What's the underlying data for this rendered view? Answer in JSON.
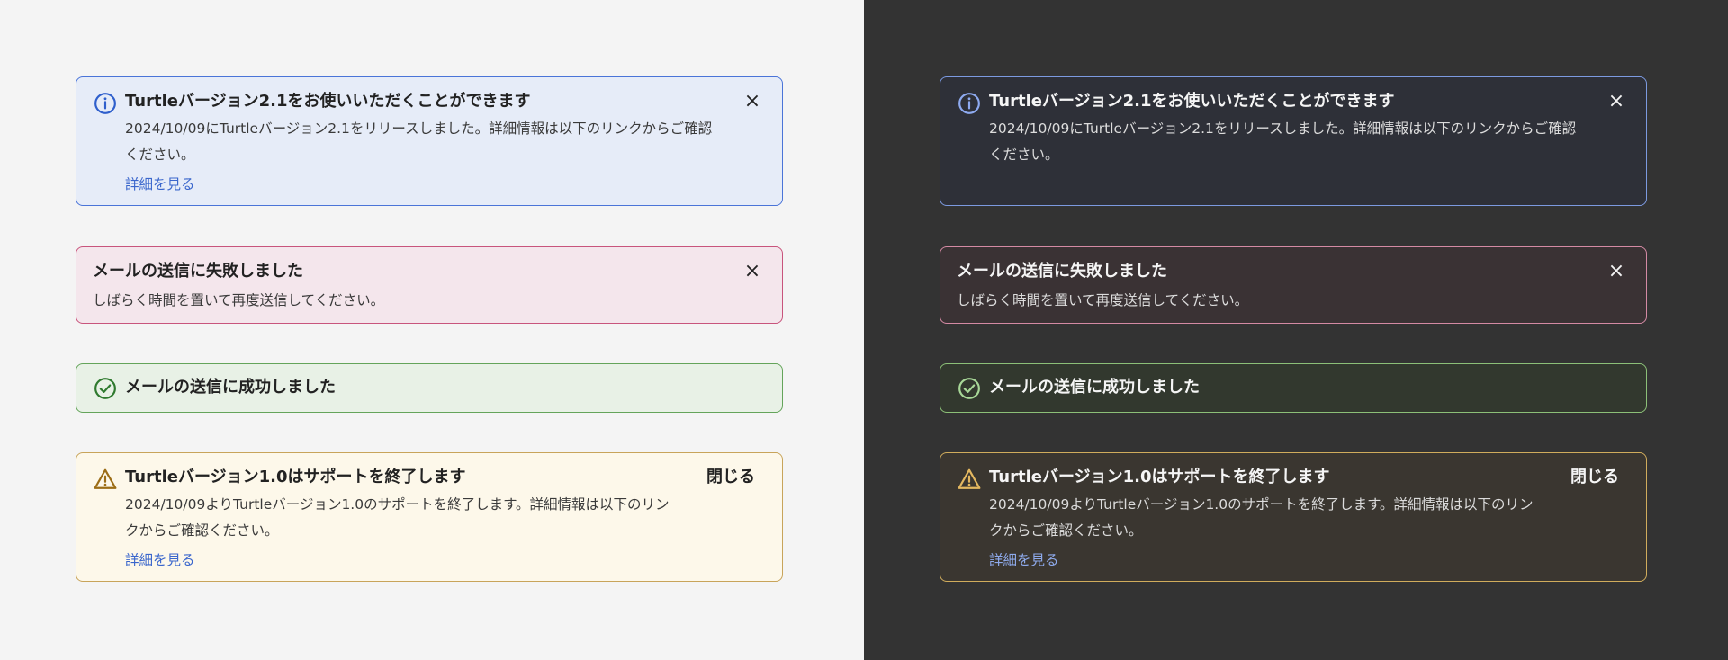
{
  "light": {
    "info": {
      "icon": "info-circle-icon",
      "title": "Turtleバージョン2.1をお使いいただくことができます",
      "body": "2024/10/09にTurtleバージョン2.1をリリースしました。詳細情報は以下のリンクからご確認ください。",
      "link": "詳細を見る",
      "close": "×"
    },
    "error": {
      "title": "メールの送信に失敗しました",
      "body": "しばらく時間を置いて再度送信してください。",
      "close": "×"
    },
    "success": {
      "icon": "check-circle-icon",
      "title": "メールの送信に成功しました"
    },
    "warning": {
      "icon": "warning-triangle-icon",
      "title": "Turtleバージョン1.0はサポートを終了します",
      "body": "2024/10/09よりTurtleバージョン1.0のサポートを終了します。詳細情報は以下のリンクからご確認ください。",
      "link": "詳細を見る",
      "close": "閉じる"
    }
  },
  "dark": {
    "info": {
      "icon": "info-circle-icon",
      "title": "Turtleバージョン2.1をお使いいただくことができます",
      "body": "2024/10/09にTurtleバージョン2.1をリリースしました。詳細情報は以下のリンクからご確認ください。",
      "close": "×"
    },
    "error": {
      "title": "メールの送信に失敗しました",
      "body": "しばらく時間を置いて再度送信してください。",
      "close": "×"
    },
    "success": {
      "icon": "check-circle-icon",
      "title": "メールの送信に成功しました"
    },
    "warning": {
      "icon": "warning-triangle-icon",
      "title": "Turtleバージョン1.0はサポートを終了します",
      "body": "2024/10/09よりTurtleバージョン1.0のサポートを終了します。詳細情報は以下のリンクからご確認ください。",
      "link": "詳細を見る",
      "close": "閉じる"
    }
  },
  "colors": {
    "light_background": "#f4f4f4",
    "dark_background": "#333333",
    "info_border_light": "#4a74d8",
    "error_border_light": "#c8547c",
    "success_border_light": "#64a45a",
    "warning_border_light": "#c8a45a",
    "info_border_dark": "#7c9ae0",
    "error_border_dark": "#d48aa4",
    "success_border_dark": "#8cc078",
    "warning_border_dark": "#d0ac5c"
  }
}
